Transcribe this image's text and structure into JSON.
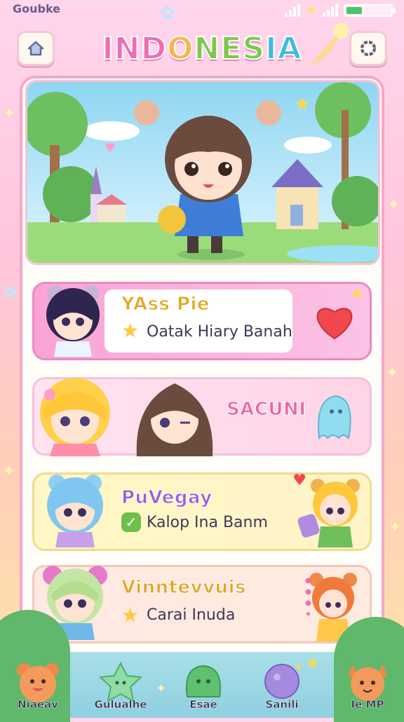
{
  "status_bar": {
    "app_name": "Goubke",
    "battery_level": 0.35
  },
  "header": {
    "title": "INDONESIA",
    "title_letters": [
      "I",
      "N",
      "D",
      "O",
      "N",
      "E",
      "S",
      "I",
      "A"
    ],
    "title_colors": [
      "#f06bb3",
      "#f06bb3",
      "#f06bb3",
      "#ffb14a",
      "#7cc94c",
      "#7cc94c",
      "#7cc94c",
      "#3cbde0",
      "#3cbde0"
    ]
  },
  "buttons": {
    "home_icon": "home-icon",
    "settings_icon": "settings-icon"
  },
  "list": [
    {
      "title": "YAss Pie",
      "subtitle": "Oatak Hiary Banah",
      "title_color": "#e2a81a",
      "badge": "star"
    },
    {
      "title": "SACUNI",
      "subtitle": "",
      "title_color": "#f062a8",
      "badge": ""
    },
    {
      "title": "PuVegay",
      "subtitle": "Kalop Ina Banm",
      "title_color": "#9a5fd8",
      "badge": "check"
    },
    {
      "title": "Vinntevvuis",
      "subtitle": "Carai Inuda",
      "title_color": "#e6a326",
      "badge": "star"
    }
  ],
  "bottom_nav": [
    {
      "label": "Niaeav",
      "icon": "bear-icon"
    },
    {
      "label": "Gulualhe",
      "icon": "star-icon"
    },
    {
      "label": "Esae",
      "icon": "slime-icon"
    },
    {
      "label": "Sanili",
      "icon": "planet-icon"
    },
    {
      "label": "Ie MP",
      "icon": "fox-icon"
    }
  ],
  "colors": {
    "accent_pink": "#f5a7c6",
    "row1": "#f9a4d5",
    "row3": "#fff7c6"
  }
}
